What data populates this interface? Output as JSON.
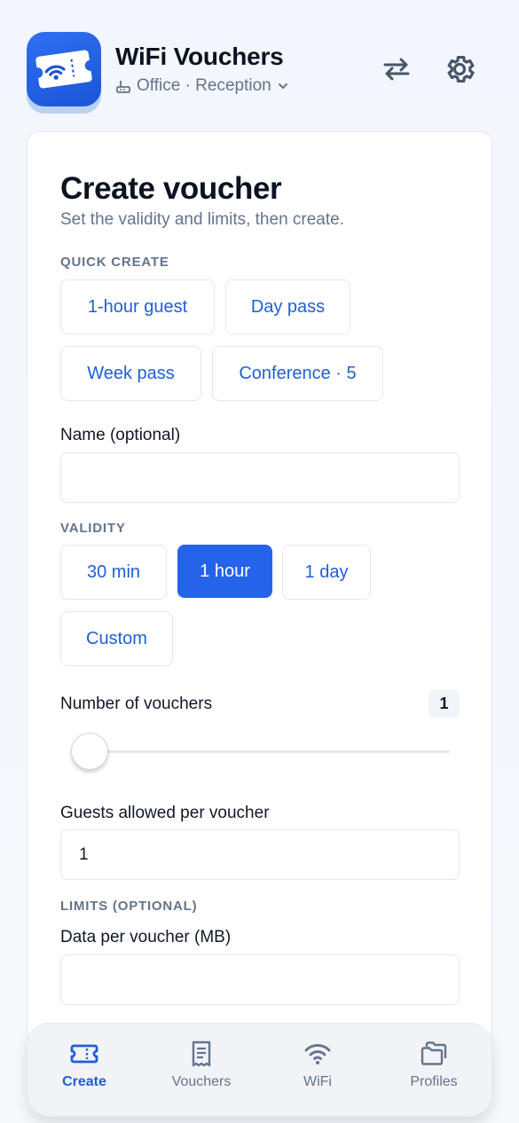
{
  "header": {
    "app_title": "WiFi Vouchers",
    "site_name": "Office · Reception"
  },
  "card": {
    "title": "Create voucher",
    "subtitle": "Set the validity and limits, then create.",
    "quick_create_label": "QUICK CREATE",
    "quick_create": [
      "1-hour guest",
      "Day pass",
      "Week pass",
      "Conference · 5"
    ],
    "name_label": "Name (optional)",
    "name_value": "",
    "validity_label": "VALIDITY",
    "validity_options": [
      "30 min",
      "1 hour",
      "1 day",
      "Custom"
    ],
    "validity_selected": "1 hour",
    "vouchers_label": "Number of vouchers",
    "vouchers_count": "1",
    "guests_label": "Guests allowed per voucher",
    "guests_value": "1",
    "limits_label": "LIMITS (OPTIONAL)",
    "data_label": "Data per voucher (MB)",
    "data_value": ""
  },
  "nav": {
    "items": [
      "Create",
      "Vouchers",
      "WiFi",
      "Profiles"
    ],
    "active": "Create"
  },
  "colors": {
    "accent": "#2563eb",
    "accent_text": "#1f5fd6",
    "muted": "#64748b"
  }
}
